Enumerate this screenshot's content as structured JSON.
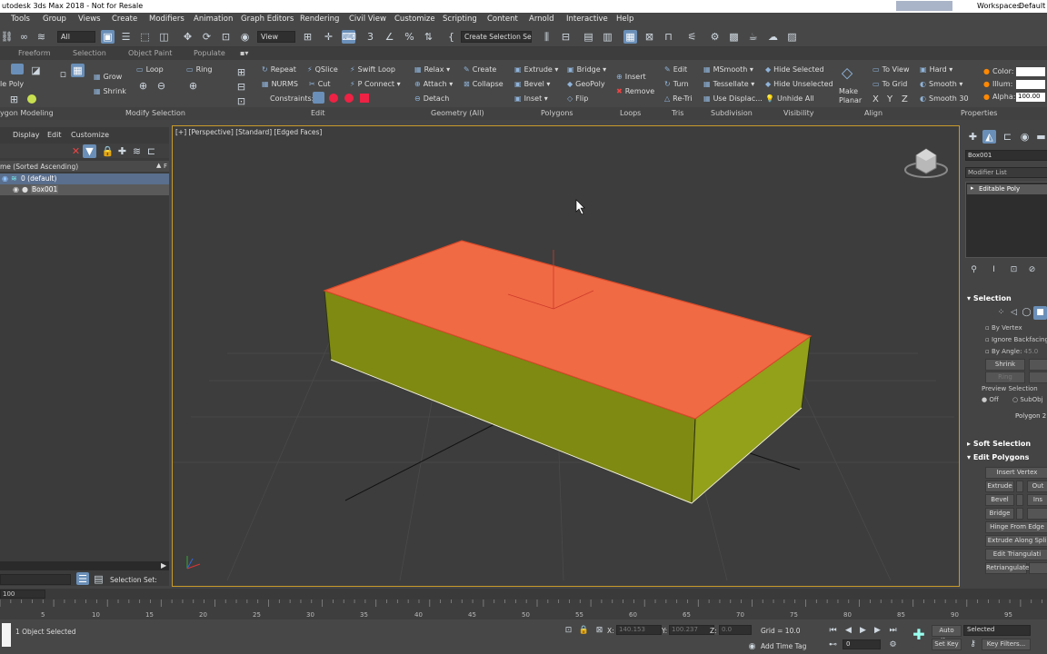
{
  "app": {
    "title": "utodesk 3ds Max 2018 - Not for Resale",
    "workspaces_label": "Workspaces:",
    "workspace": "Default"
  },
  "menu": [
    "Tools",
    "Group",
    "Views",
    "Create",
    "Modifiers",
    "Animation",
    "Graph Editors",
    "Rendering",
    "Civil View",
    "Customize",
    "Scripting",
    "Content",
    "Arnold",
    "Interactive",
    "Help"
  ],
  "toolbar": {
    "filter": "All",
    "ref_coord": "View",
    "selection_set": "Create Selection Se"
  },
  "ribbon_tabs": [
    "Freeform",
    "Selection",
    "Object Paint",
    "Populate"
  ],
  "ribbon": {
    "left_label": "le Poly",
    "modify_sel": {
      "grow": "Grow",
      "shrink": "Shrink",
      "loop": "Loop",
      "ring": "Ring"
    },
    "edit": {
      "repeat": "Repeat",
      "qslice": "QSlice",
      "swift_loop": "Swift Loop",
      "nurms": "NURMS",
      "cut": "Cut",
      "p_connect": "P Connect",
      "constraints": "Constraints:"
    },
    "geometry": {
      "relax": "Relax",
      "create": "Create",
      "attach": "Attach",
      "collapse": "Collapse",
      "detach": "Detach"
    },
    "polygons": {
      "extrude": "Extrude",
      "bridge": "Bridge",
      "bevel": "Bevel",
      "geopoly": "GeoPoly",
      "inset": "Inset",
      "flip": "Flip"
    },
    "loops": {
      "insert": "Insert",
      "remove": "Remove"
    },
    "tris": {
      "edit": "Edit",
      "turn": "Turn",
      "retri": "Re-Tri"
    },
    "subdivision": {
      "msmooth": "MSmooth",
      "tessellate": "Tessellate",
      "use_displace": "Use Displac..."
    },
    "visibility": {
      "hide_sel": "Hide Selected",
      "hide_unsel": "Hide Unselected",
      "unhide_all": "Unhide All"
    },
    "align": {
      "make_planar": "Make Planar",
      "to_view": "To View",
      "to_grid": "To Grid",
      "x": "X",
      "y": "Y",
      "z": "Z"
    },
    "smooth": {
      "hard": "Hard",
      "smooth": "Smooth",
      "smooth30": "Smooth 30"
    },
    "props": {
      "color": "Color:",
      "illum": "Illum:",
      "alpha": "Alpha:",
      "alpha_val": "100.00"
    },
    "panels": [
      "ygon Modeling",
      "Modify Selection",
      "Edit",
      "Geometry (All)",
      "Polygons",
      "Loops",
      "Tris",
      "Subdivision",
      "Visibility",
      "Align",
      "Properties"
    ]
  },
  "scene_explorer": {
    "menus": [
      "Display",
      "Edit",
      "Customize"
    ],
    "sort_header": "me (Sorted Ascending)",
    "sort_col": "F",
    "items": [
      "0 (default)",
      "Box001"
    ]
  },
  "viewport": {
    "label": "[+] [Perspective] [Standard] [Edged Faces]"
  },
  "colors": {
    "top_face": "#f06a44",
    "side_face": "#7f8a12",
    "front_face": "#93a01a",
    "accent": "#6a8fb8"
  },
  "command_panel": {
    "object_name": "Box001",
    "modifier_list": "Modifier List",
    "stack": [
      "Editable Poly"
    ],
    "selection": {
      "header": "Selection",
      "by_vertex": "By Vertex",
      "ignore_backfacing": "Ignore Backfacing",
      "by_angle": "By Angle:",
      "angle": "45.0",
      "shrink": "Shrink",
      "ring": "Ring",
      "preview": "Preview Selection",
      "off": "Off",
      "subobj": "SubObj",
      "status": "Polygon 2"
    },
    "soft_selection": "Soft Selection",
    "edit_polygons": {
      "header": "Edit Polygons",
      "insert_vertex": "Insert Vertex",
      "extrude": "Extrude",
      "outline": "Out",
      "bevel": "Bevel",
      "inset": "Ins",
      "bridge": "Bridge",
      "hinge": "Hinge From Edge",
      "extrude_spline": "Extrude Along Spli",
      "edit_tri": "Edit Triangulati",
      "retri": "Retriangulate"
    }
  },
  "timeline": {
    "frame": "100",
    "ticks": [
      "5",
      "10",
      "15",
      "20",
      "25",
      "30",
      "35",
      "40",
      "45",
      "50",
      "55",
      "60",
      "65",
      "70",
      "75",
      "80",
      "85",
      "90",
      "95"
    ]
  },
  "status": {
    "selected": "1 Object Selected",
    "selection_set": "Selection Set:",
    "x_label": "X:",
    "x": "140.153",
    "y_label": "Y:",
    "y": "100.237",
    "z_label": "Z:",
    "z": "0.0",
    "grid": "Grid = 10.0",
    "add_time_tag": "Add Time Tag",
    "frame": "0",
    "auto_key": "Auto Key",
    "selected_dd": "Selected",
    "set_key": "Set Key",
    "key_filters": "Key Filters..."
  }
}
